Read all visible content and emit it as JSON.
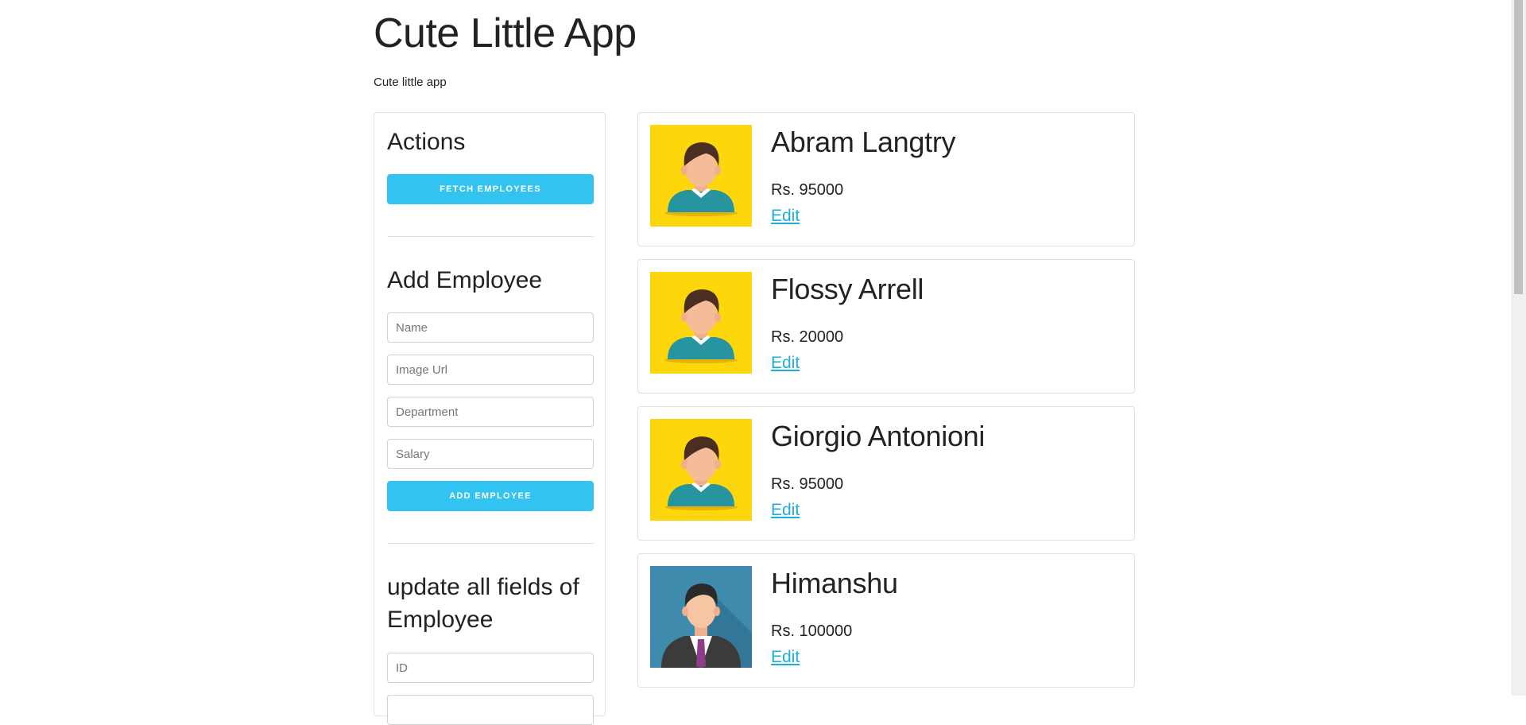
{
  "app": {
    "title": "Cute Little App",
    "subtitle": "Cute little app"
  },
  "sidebar": {
    "actions_title": "Actions",
    "fetch_button": "FETCH EMPLOYEES",
    "add_title": "Add Employee",
    "add_fields": {
      "name_placeholder": "Name",
      "image_placeholder": "Image Url",
      "department_placeholder": "Department",
      "salary_placeholder": "Salary"
    },
    "add_button": "ADD EMPLOYEE",
    "update_title": "update all fields of Employee",
    "update_fields": {
      "id_placeholder": "ID"
    }
  },
  "employees": [
    {
      "name": "Abram Langtry",
      "salary": "Rs. 95000",
      "edit": "Edit",
      "avatar": "casual-avatar-icon"
    },
    {
      "name": "Flossy Arrell",
      "salary": "Rs. 20000",
      "edit": "Edit",
      "avatar": "casual-avatar-icon"
    },
    {
      "name": "Giorgio Antonioni",
      "salary": "Rs. 95000",
      "edit": "Edit",
      "avatar": "casual-avatar-icon"
    },
    {
      "name": "Himanshu",
      "salary": "Rs. 100000",
      "edit": "Edit",
      "avatar": "business-avatar-icon"
    }
  ],
  "colors": {
    "button": "#33c3f0",
    "link": "#1eaedb",
    "avatar_yellow": "#fdd60b",
    "avatar_blue": "#3e8bae"
  }
}
